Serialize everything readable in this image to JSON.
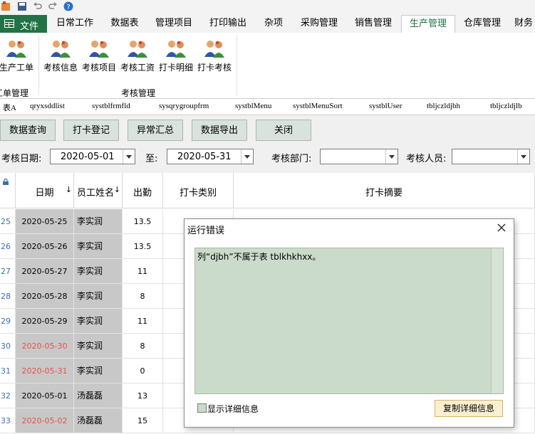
{
  "ribbon_tabs": [
    {
      "label": "文件"
    },
    {
      "label": "日常工作"
    },
    {
      "label": "数据表"
    },
    {
      "label": "管理项目"
    },
    {
      "label": "打印输出"
    },
    {
      "label": "杂项"
    },
    {
      "label": "采购管理"
    },
    {
      "label": "销售管理"
    },
    {
      "label": "生产管理"
    },
    {
      "label": "仓库管理"
    },
    {
      "label": "财务"
    }
  ],
  "active_tab": "生产管理",
  "ribbon": {
    "buttons": [
      "生产工单",
      "考核信息",
      "考核项目",
      "考核工资",
      "打卡明细",
      "打卡考核"
    ],
    "groups": [
      "工单管理",
      "考核管理"
    ]
  },
  "doc_tabs": [
    "表A",
    "qryxsddlist",
    "systblfrmfld",
    "sysqrygroupfrm",
    "systblMenu",
    "systblMenuSort",
    "systblUser",
    "tbljczldjbh",
    "tbljczldjlb"
  ],
  "toolbar": [
    "数据查询",
    "打卡登记",
    "异常汇总",
    "数据导出",
    "关闭"
  ],
  "filters": {
    "date_label": "考核日期:",
    "date_from": "2020-05-01",
    "to_label": "至:",
    "date_to": "2020-05-31",
    "dept_label": "考核部门:",
    "dept_value": "",
    "person_label": "考核人员:",
    "person_value": ""
  },
  "grid": {
    "headers": {
      "date": "日期",
      "name": "员工姓名",
      "att": "出勤",
      "type": "打卡类别",
      "summary": "打卡摘要"
    },
    "rows": [
      {
        "no": "25",
        "date": "2020-05-25",
        "name": "李实润",
        "att": "13.5",
        "red": false
      },
      {
        "no": "26",
        "date": "2020-05-26",
        "name": "李实润",
        "att": "13.5",
        "red": false
      },
      {
        "no": "27",
        "date": "2020-05-27",
        "name": "李实润",
        "att": "11",
        "red": false
      },
      {
        "no": "28",
        "date": "2020-05-28",
        "name": "李实润",
        "att": "8",
        "red": false
      },
      {
        "no": "29",
        "date": "2020-05-29",
        "name": "李实润",
        "att": "11",
        "red": false
      },
      {
        "no": "30",
        "date": "2020-05-30",
        "name": "李实润",
        "att": "8",
        "red": true
      },
      {
        "no": "31",
        "date": "2020-05-31",
        "name": "李实润",
        "att": "0",
        "red": true
      },
      {
        "no": "32",
        "date": "2020-05-01",
        "name": "汤磊磊",
        "att": "13",
        "red": false
      },
      {
        "no": "33",
        "date": "2020-05-02",
        "name": "汤磊磊",
        "att": "15",
        "red": true
      }
    ]
  },
  "dialog": {
    "title": "运行错误",
    "message": "列“djbh”不属于表 tblkhkhxx。",
    "checkbox_label": "显示详细信息",
    "copy_button": "复制详细信息"
  },
  "colors": {
    "accent": "#217346",
    "highlight_red": "#e8524a",
    "dialog_bg": "#cadbcb"
  }
}
